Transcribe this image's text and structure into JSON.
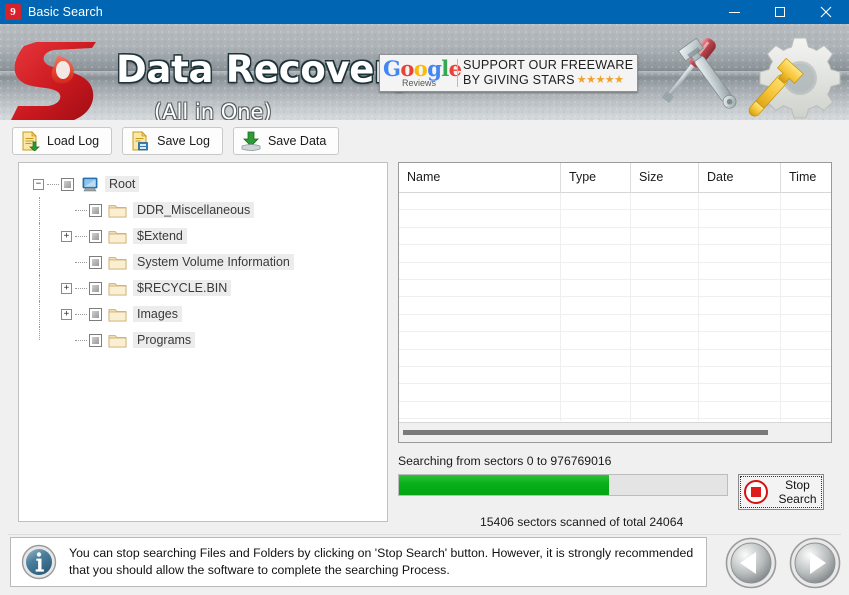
{
  "window": {
    "title": "Basic Search",
    "app_icon": "app-logo-icon",
    "minimize": "minimize-icon",
    "maximize": "maximize-icon",
    "close": "close-icon"
  },
  "banner": {
    "title": "Data Recovery",
    "subtitle": "(All in One)",
    "google": {
      "logo_g": "G",
      "logo_o1": "o",
      "logo_o2": "o",
      "logo_g2": "g",
      "logo_l": "l",
      "logo_e": "e",
      "reviews": "Reviews",
      "line1": "SUPPORT OUR FREEWARE",
      "line2": "BY GIVING STARS",
      "stars": "★★★★★"
    }
  },
  "toolbar": {
    "buttons": [
      {
        "label": "Load Log",
        "icon": "load-log-icon"
      },
      {
        "label": "Save Log",
        "icon": "save-log-icon"
      },
      {
        "label": "Save Data",
        "icon": "save-data-icon"
      }
    ]
  },
  "tree": {
    "root": {
      "label": "Root",
      "icon": "computer-icon",
      "expander": "−"
    },
    "nodes": [
      {
        "label": "DDR_Miscellaneous",
        "icon": "folder-icon",
        "expander": ""
      },
      {
        "label": "$Extend",
        "icon": "folder-icon",
        "expander": "+"
      },
      {
        "label": "System Volume Information",
        "icon": "folder-icon",
        "expander": ""
      },
      {
        "label": "$RECYCLE.BIN",
        "icon": "folder-icon",
        "expander": "+"
      },
      {
        "label": "Images",
        "icon": "folder-icon",
        "expander": "+"
      },
      {
        "label": "Programs",
        "icon": "folder-icon",
        "expander": ""
      }
    ]
  },
  "list": {
    "columns": [
      {
        "label": "Name"
      },
      {
        "label": "Type"
      },
      {
        "label": "Size"
      },
      {
        "label": "Date"
      },
      {
        "label": "Time"
      }
    ],
    "rows": [],
    "row_count": 14
  },
  "progress": {
    "range_text": "Searching from sectors   0 to 976769016",
    "sectors_scanned": "15406",
    "total_sectors": "24064",
    "scanned_text": "15406   sectors scanned of total 24064",
    "percent": 64,
    "fill_color": "#06af17",
    "stop_button": {
      "line1": "Stop",
      "line2": "Search",
      "icon": "stop-icon"
    }
  },
  "footer": {
    "info_icon": "info-icon",
    "message": "You can stop searching Files and Folders by clicking on 'Stop Search' button. However, it is strongly recommended that you should allow the software to complete the searching Process.",
    "nav": {
      "back": "back-arrow-icon",
      "next": "next-arrow-icon"
    }
  }
}
